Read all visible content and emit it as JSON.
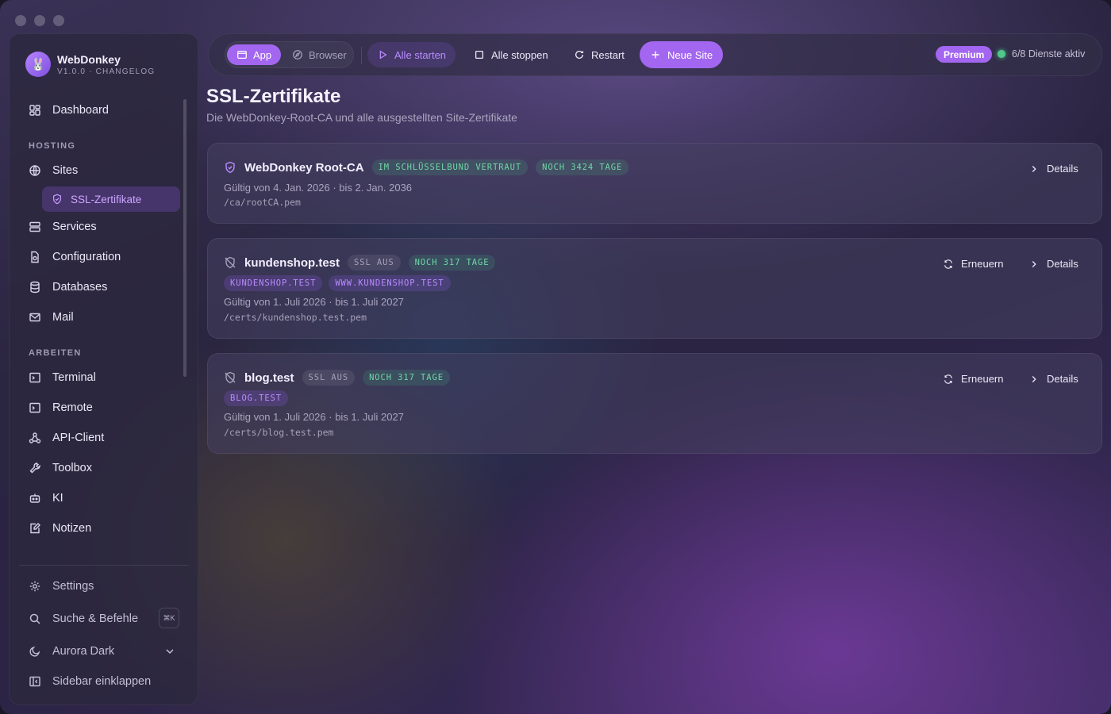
{
  "app": {
    "name": "WebDonkey",
    "version": "V1.0.0 · CHANGELOG",
    "avatar_glyph": "🐰"
  },
  "sidebar": {
    "dashboard": "Dashboard",
    "section_hosting": "HOSTING",
    "sites": "Sites",
    "ssl": "SSL-Zertifikate",
    "services": "Services",
    "configuration": "Configuration",
    "databases": "Databases",
    "mail": "Mail",
    "section_arbeiten": "ARBEITEN",
    "terminal": "Terminal",
    "remote": "Remote",
    "api_client": "API-Client",
    "toolbox": "Toolbox",
    "ki": "KI",
    "notizen": "Notizen",
    "settings": "Settings",
    "search": "Suche & Befehle",
    "search_kbd": "⌘K",
    "theme": "Aurora Dark",
    "collapse": "Sidebar einklappen"
  },
  "toolbar": {
    "app": "App",
    "browser": "Browser",
    "start_all": "Alle starten",
    "stop_all": "Alle stoppen",
    "restart": "Restart",
    "new_site": "Neue Site",
    "premium": "Premium",
    "services_status": "6/8 Dienste aktiv"
  },
  "page": {
    "title": "SSL-Zertifikate",
    "subtitle": "Die WebDonkey-Root-CA und alle ausgestellten Site-Zertifikate"
  },
  "certs": [
    {
      "name": "WebDonkey Root-CA",
      "badge1": "IM SCHLÜSSELBUND VERTRAUT",
      "badge2": "NOCH 3424 TAGE",
      "dates": "Gültig von 4. Jan. 2026 · bis 2. Jan. 2036",
      "path": "/ca/rootCA.pem",
      "details": "Details"
    },
    {
      "name": "kundenshop.test",
      "badge1": "SSL AUS",
      "badge2": "NOCH 317 TAGE",
      "domains": [
        "KUNDENSHOP.TEST",
        "WWW.KUNDENSHOP.TEST"
      ],
      "dates": "Gültig von 1. Juli 2026 · bis 1. Juli 2027",
      "path": "/certs/kundenshop.test.pem",
      "renew": "Erneuern",
      "details": "Details"
    },
    {
      "name": "blog.test",
      "badge1": "SSL AUS",
      "badge2": "NOCH 317 TAGE",
      "domains": [
        "BLOG.TEST"
      ],
      "dates": "Gültig von 1. Juli 2026 · bis 1. Juli 2027",
      "path": "/certs/blog.test.pem",
      "renew": "Erneuern",
      "details": "Details"
    }
  ],
  "colors": {
    "accent": "#a366f0",
    "success": "#4fc88a"
  }
}
